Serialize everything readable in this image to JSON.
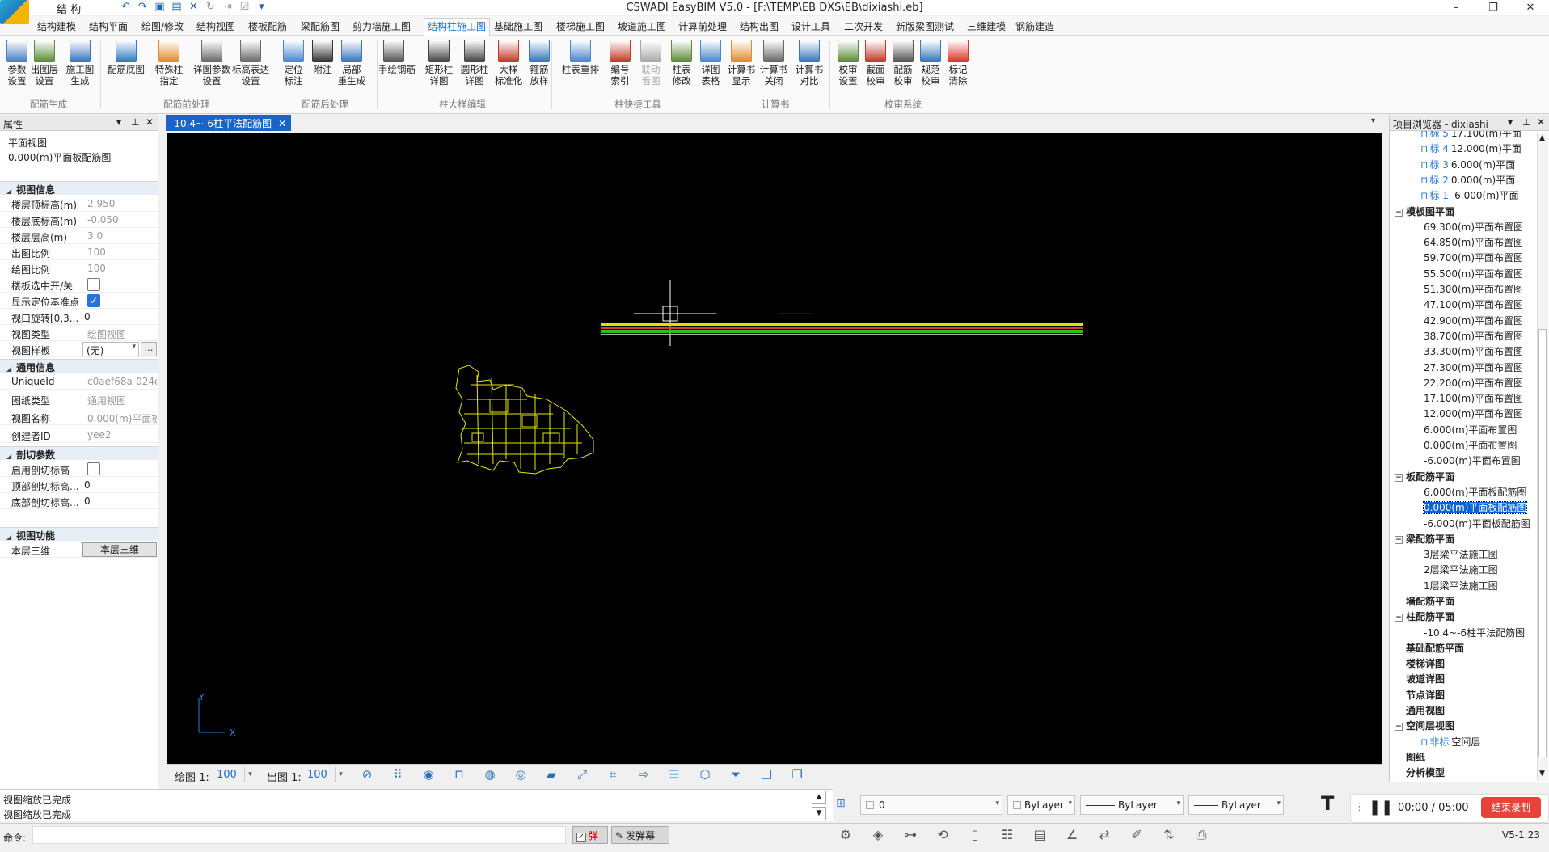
{
  "titlebar": {
    "title": "CSWADI EasyBIM V5.0 - [F:\\TEMP\\EB DXS\\EB\\dixiashi.eb]",
    "qa_label": "结 构"
  },
  "menu": {
    "tabs": [
      "结构建模",
      "结构平面",
      "绘图/修改",
      "结构视图",
      "楼板配筋",
      "梁配筋图",
      "剪力墙施工图",
      "结构柱施工图",
      "基础施工图",
      "楼梯施工图",
      "坡道施工图",
      "计算前处理",
      "结构出图",
      "设计工具",
      "二次开发",
      "新版梁图测试",
      "三维建模",
      "钢筋建造"
    ],
    "active_index": 7
  },
  "ribbon": {
    "buttons": [
      {
        "label": "参数\n设置",
        "color": "#4a7fc0"
      },
      {
        "label": "出图层\n设置",
        "color": "#5b8b3a"
      },
      {
        "label": "施工图\n生成",
        "color": "#3a76b8"
      },
      {
        "label": "配筋底图",
        "color": "#2f7ac4"
      },
      {
        "label": "特殊柱\n指定",
        "color": "#e28b2c"
      },
      {
        "label": "详图参数\n设置",
        "color": "#6a6a6a"
      },
      {
        "label": "标高表达\n设置",
        "color": "#6a6a6a"
      },
      {
        "label": "定位\n标注",
        "color": "#4b86c9"
      },
      {
        "label": "附注",
        "color": "#333333"
      },
      {
        "label": "局部\n重生成",
        "color": "#3a76b8"
      },
      {
        "label": "手绘钢筋",
        "color": "#555555"
      },
      {
        "label": "矩形柱\n详图",
        "color": "#444444"
      },
      {
        "label": "圆形柱\n详图",
        "color": "#444444"
      },
      {
        "label": "大样\n标准化",
        "color": "#c0392b"
      },
      {
        "label": "箍筋\n放样",
        "color": "#3a76b8"
      },
      {
        "label": "柱表重排",
        "color": "#4b86c9"
      },
      {
        "label": "编号\n索引",
        "color": "#c0392b"
      },
      {
        "label": "联动\n看图",
        "color": "#aaaaaa"
      },
      {
        "label": "柱表\n修改",
        "color": "#5b8b3a"
      },
      {
        "label": "详图\n表格",
        "color": "#4b86c9"
      },
      {
        "label": "计算书\n显示",
        "color": "#e28b2c"
      },
      {
        "label": "计算书\n关闭",
        "color": "#666666"
      },
      {
        "label": "计算书\n对比",
        "color": "#3a76b8"
      },
      {
        "label": "校审\n设置",
        "color": "#5b8b3a"
      },
      {
        "label": "截面\n校审",
        "color": "#c0392b"
      },
      {
        "label": "配筋\n校审",
        "color": "#555555"
      },
      {
        "label": "规范\n校审",
        "color": "#3a76b8"
      },
      {
        "label": "标记\n清除",
        "color": "#d9342b"
      }
    ],
    "groups": [
      "配筋生成",
      "配筋前处理",
      "配筋后处理",
      "柱大样编辑",
      "柱快捷工具",
      "计算书",
      "校审系统"
    ]
  },
  "props": {
    "title": "属性",
    "view_type_line": "平面视图",
    "view_name_line": "0.000(m)平面板配筋图",
    "sections": {
      "view_info": "视图信息",
      "general_info": "通用信息",
      "cut_params": "剖切参数",
      "view_func": "视图功能"
    },
    "rows": {
      "top_elev_k": "楼层顶标高(m)",
      "top_elev_v": "2.950",
      "bot_elev_k": "楼层底标高(m)",
      "bot_elev_v": "-0.050",
      "floor_h_k": "楼层层高(m)",
      "floor_h_v": "3.0",
      "out_scale_k": "出图比例",
      "out_scale_v": "100",
      "draw_scale_k": "绘图比例",
      "draw_scale_v": "100",
      "slab_toggle_k": "楼板选中开/关",
      "show_ref_k": "显示定位基准点",
      "rotate_k": "视口旋转[0,3...",
      "rotate_v": "0",
      "view_kind_k": "视图类型",
      "view_kind_v": "绘图视图",
      "view_tpl_k": "视图样板",
      "view_tpl_v": "(无)",
      "uid_k": "UniqueId",
      "uid_v": "c0aef68a-024e",
      "sheet_type_k": "图纸类型",
      "sheet_type_v": "通用视图",
      "view_name_k": "视图名称",
      "view_name_v": "0.000(m)平面板",
      "creator_k": "创建者ID",
      "creator_v": "yee2",
      "enable_cut_k": "启用剖切标高",
      "top_cut_k": "顶部剖切标高...",
      "top_cut_v": "0",
      "bot_cut_k": "底部剖切标高...",
      "bot_cut_v": "0",
      "layer3d_k": "本层三维",
      "layer3d_btn": "本层三维"
    }
  },
  "doc_tab": {
    "label": "-10.4~-6柱平法配筋图"
  },
  "canvas_bar": {
    "draw_label": "绘图 1:",
    "draw_value": "100",
    "out_label": "出图 1:",
    "out_value": "100"
  },
  "browser": {
    "title": "项目浏览器 - dixiashi",
    "elev_items": [
      {
        "tag": "标 5",
        "text": "17.100(m)平面"
      },
      {
        "tag": "标 4",
        "text": "12.000(m)平面"
      },
      {
        "tag": "标 3",
        "text": "6.000(m)平面"
      },
      {
        "tag": "标 2",
        "text": "0.000(m)平面"
      },
      {
        "tag": "标 1",
        "text": "-6.000(m)平面"
      }
    ],
    "slab_plan_title": "模板图平面",
    "slab_plan_items": [
      "69.300(m)平面布置图",
      "64.850(m)平面布置图",
      "59.700(m)平面布置图",
      "55.500(m)平面布置图",
      "51.300(m)平面布置图",
      "47.100(m)平面布置图",
      "42.900(m)平面布置图",
      "38.700(m)平面布置图",
      "33.300(m)平面布置图",
      "27.300(m)平面布置图",
      "22.200(m)平面布置图",
      "17.100(m)平面布置图",
      "12.000(m)平面布置图",
      "6.000(m)平面布置图",
      "0.000(m)平面布置图",
      "-6.000(m)平面布置图"
    ],
    "slab_rebar_title": "板配筋平面",
    "slab_rebar_items": [
      "6.000(m)平面板配筋图",
      "0.000(m)平面板配筋图",
      "-6.000(m)平面板配筋图"
    ],
    "beam_title": "梁配筋平面",
    "beam_items": [
      "3层梁平法施工图",
      "2层梁平法施工图",
      "1层梁平法施工图"
    ],
    "wall_title": "墙配筋平面",
    "col_title": "柱配筋平面",
    "col_items": [
      "-10.4~-6柱平法配筋图"
    ],
    "others": [
      "基础配筋平面",
      "楼梯详图",
      "坡道详图",
      "节点详图",
      "通用视图"
    ],
    "space_title": "空间层视图",
    "space_item_tag": "非标",
    "space_item_text": "空间层",
    "tail": [
      "图纸",
      "分析模型"
    ]
  },
  "messages": [
    "视图缩放已完成",
    "视图缩放已完成"
  ],
  "layerbar": {
    "layer": "0",
    "color": "ByLayer",
    "linetype": "ByLayer",
    "lineweight": "ByLayer"
  },
  "recorder": {
    "time": "00:00 / 05:00",
    "stop_label": "结束录制"
  },
  "status": {
    "cmd_label": "命令:",
    "toggle1": "弹",
    "toggle2": "发弹幕",
    "version": "V5-1.23"
  }
}
